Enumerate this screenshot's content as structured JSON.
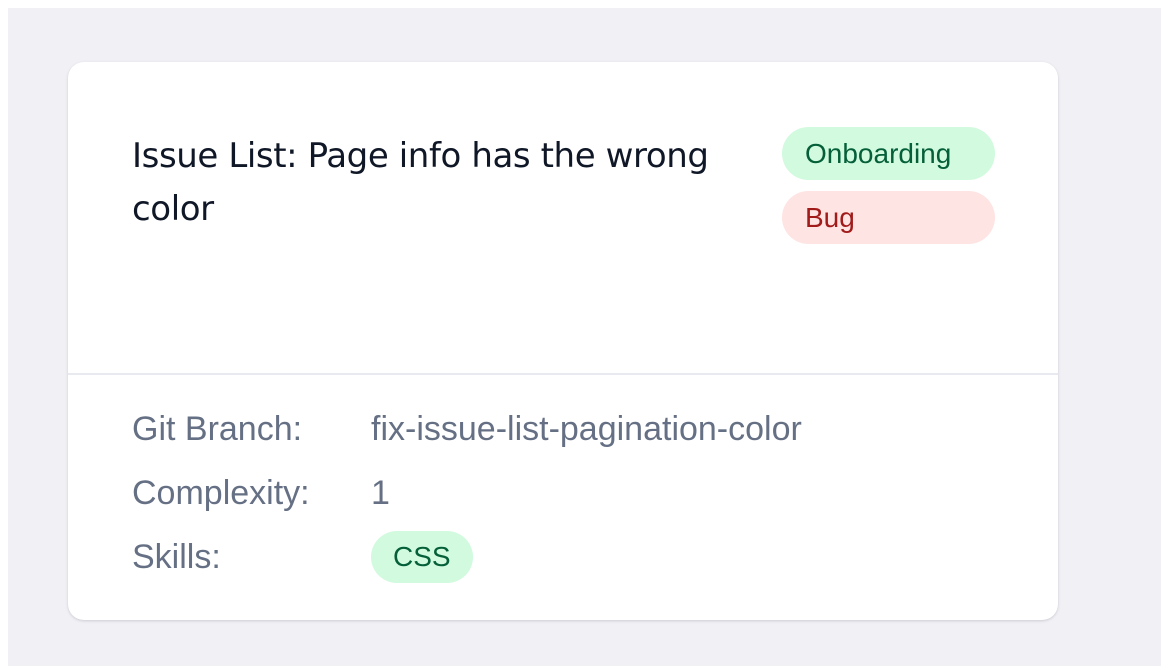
{
  "issue": {
    "title": "Issue List: Page info has the wrong color",
    "badges": [
      {
        "label": "Onboarding",
        "color": "#d1fadf",
        "text_color": "#05603a"
      },
      {
        "label": "Bug",
        "color": "#fee4e2",
        "text_color": "#a11b1b"
      }
    ]
  },
  "details": {
    "branch_label": "Git Branch:",
    "branch_value": "fix-issue-list-pagination-color",
    "complexity_label": "Complexity:",
    "complexity_value": "1",
    "skills_label": "Skills:",
    "skills": [
      "CSS"
    ]
  },
  "colors": {
    "background": "#f0f0f5",
    "card": "#ffffff",
    "title_text": "#101828",
    "detail_text": "#667085"
  }
}
